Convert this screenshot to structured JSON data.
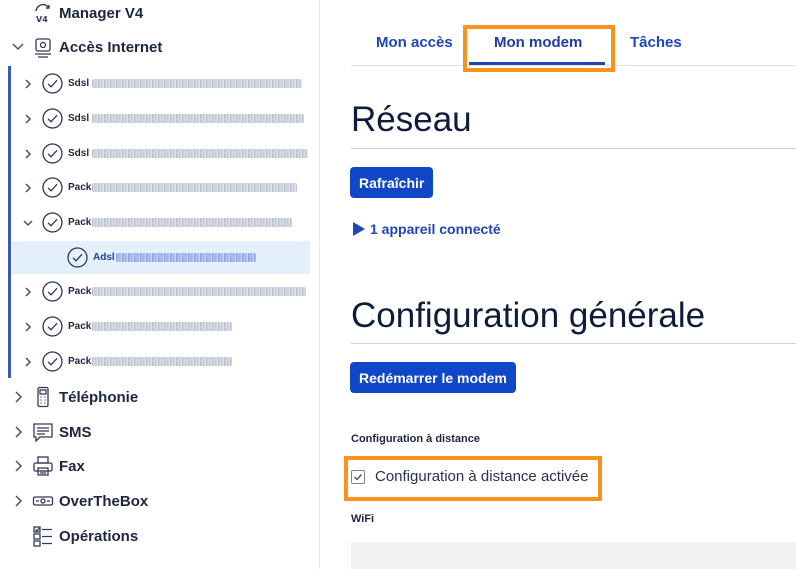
{
  "sidebar": {
    "manager": {
      "label": "Manager V4",
      "icon": "manager-v4-icon"
    },
    "internet": {
      "label": "Accès Internet",
      "icon": "internet-modem-icon",
      "expanded": true
    },
    "subitems": [
      {
        "kind": "Sdsl",
        "status": "ok",
        "expanded": false
      },
      {
        "kind": "Sdsl",
        "status": "ok",
        "expanded": false
      },
      {
        "kind": "Sdsl",
        "status": "ok",
        "expanded": false
      },
      {
        "kind": "Pack",
        "status": "ok",
        "expanded": false
      },
      {
        "kind": "Pack",
        "status": "ok",
        "expanded": true
      },
      {
        "kind": "Adsl",
        "status": "ok",
        "selected": true
      },
      {
        "kind": "Pack",
        "status": "ok",
        "expanded": false
      },
      {
        "kind": "Pack",
        "status": "ok",
        "expanded": false
      },
      {
        "kind": "Pack",
        "status": "ok",
        "expanded": false
      }
    ],
    "telephonie": {
      "label": "Téléphonie",
      "icon": "phone-icon"
    },
    "sms": {
      "label": "SMS",
      "icon": "sms-icon"
    },
    "fax": {
      "label": "Fax",
      "icon": "fax-icon"
    },
    "overthebox": {
      "label": "OverTheBox",
      "icon": "overthebox-icon"
    },
    "operations": {
      "label": "Opérations",
      "icon": "operations-list-icon"
    }
  },
  "tabs": [
    {
      "label": "Mon accès",
      "active": false
    },
    {
      "label": "Mon modem",
      "active": true
    },
    {
      "label": "Tâches",
      "active": false
    }
  ],
  "reseau": {
    "title": "Réseau",
    "refresh_label": "Rafraîchir",
    "devices_label": "1 appareil connecté"
  },
  "config": {
    "title": "Configuration générale",
    "reboot_label": "Redémarrer le modem",
    "remote_section_label": "Configuration à distance",
    "remote_checkbox_label": "Configuration à distance activée",
    "remote_checked": true,
    "wifi_section_label": "WiFi"
  },
  "colors": {
    "primary": "#0f47c8",
    "link": "#1e46b8",
    "highlight": "#f7941d",
    "selected_bg": "#e4f0fb",
    "sidebar_accent": "#3c59b5"
  }
}
